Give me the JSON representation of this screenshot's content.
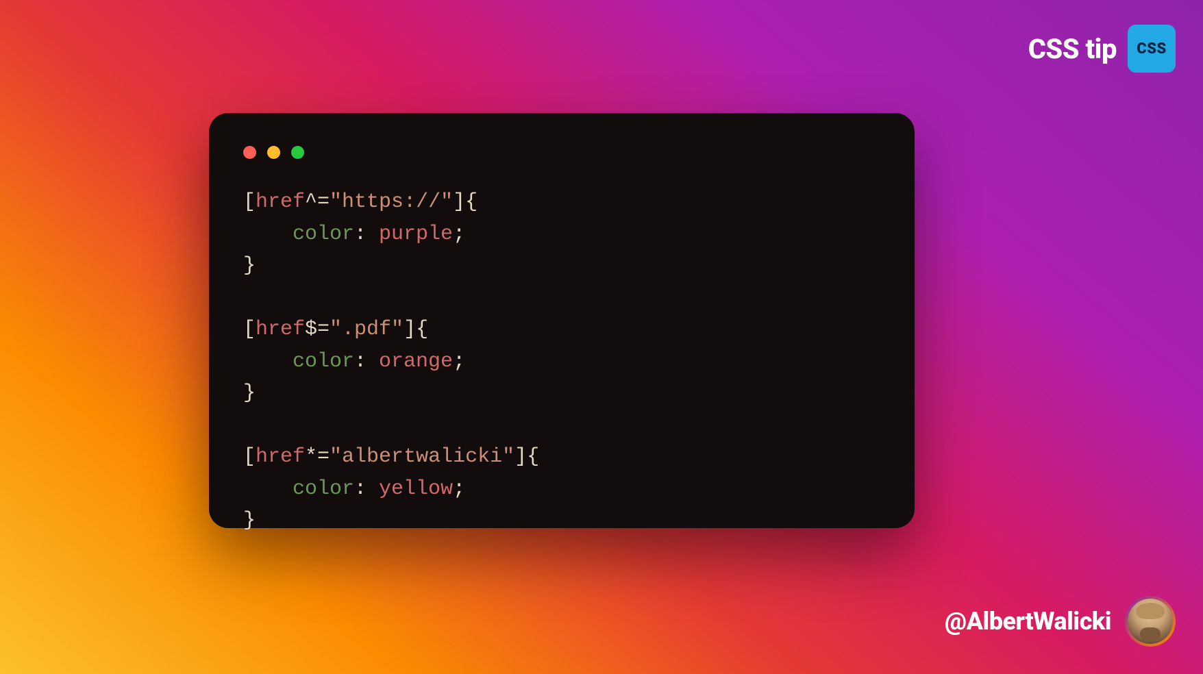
{
  "badge": {
    "text": "CSS tip",
    "icon_label": "CSS"
  },
  "code": {
    "rules": [
      {
        "bracket_open": "[",
        "attr": "href",
        "op": "^=",
        "string": "\"https://\"",
        "bracket_close": "]{",
        "prop": "color",
        "colon": ": ",
        "value": "purple",
        "semi": ";",
        "close": "}"
      },
      {
        "bracket_open": "[",
        "attr": "href",
        "op": "$=",
        "string": "\".pdf\"",
        "bracket_close": "]{",
        "prop": "color",
        "colon": ": ",
        "value": "orange",
        "semi": ";",
        "close": "}"
      },
      {
        "bracket_open": "[",
        "attr": "href",
        "op": "*=",
        "string": "\"albertwalicki\"",
        "bracket_close": "]{",
        "prop": "color",
        "colon": ": ",
        "value": "yellow",
        "semi": ";",
        "close": "}"
      }
    ]
  },
  "handle": "@AlbertWalicki",
  "colors": {
    "window_bg": "#130c0c",
    "badge_bg": "#23a8e6"
  }
}
